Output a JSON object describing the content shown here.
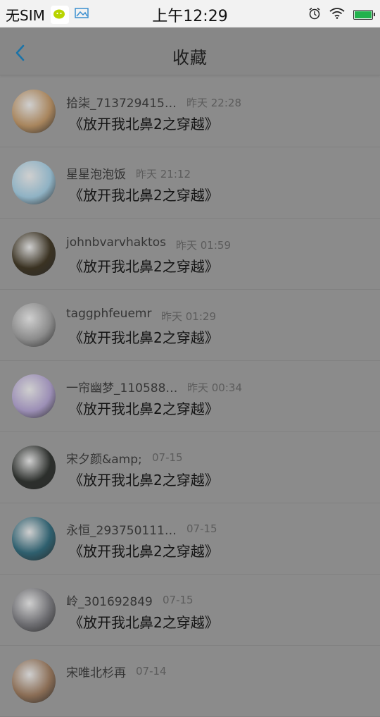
{
  "status_bar": {
    "carrier": "无SIM",
    "time": "上午12:29",
    "battery_level": 1.0,
    "icons": [
      "wechat-icon",
      "photo-icon",
      "alarm-icon",
      "wifi-icon",
      "battery-icon"
    ]
  },
  "nav": {
    "title": "收藏",
    "back_icon": "chevron-left-icon",
    "accent_color": "#1a73a8"
  },
  "items": [
    {
      "name": "拾柒_713729415…",
      "time": "昨天 22:28",
      "book": "《放开我北鼻2之穿越》",
      "avatar_color": "#a8855d"
    },
    {
      "name": "星星泡泡饭",
      "time": "昨天 21:12",
      "book": "《放开我北鼻2之穿越》",
      "avatar_color": "#8fb2c4"
    },
    {
      "name": "johnbvarvhaktos",
      "time": "昨天 01:59",
      "book": "《放开我北鼻2之穿越》",
      "avatar_color": "#3a3222"
    },
    {
      "name": "taggphfeuemr",
      "time": "昨天 01:29",
      "book": "《放开我北鼻2之穿越》",
      "avatar_color": "#8b8b8b"
    },
    {
      "name": "一帘幽梦_110588…",
      "time": "昨天 00:34",
      "book": "《放开我北鼻2之穿越》",
      "avatar_color": "#9c8fb6"
    },
    {
      "name": "宋夕颜&amp;",
      "time": "07-15",
      "book": "《放开我北鼻2之穿越》",
      "avatar_color": "#2c2f2c"
    },
    {
      "name": "永恒_293750111…",
      "time": "07-15",
      "book": "《放开我北鼻2之穿越》",
      "avatar_color": "#2e5f6e"
    },
    {
      "name": "岭_301692849",
      "time": "07-15",
      "book": "《放开我北鼻2之穿越》",
      "avatar_color": "#6e6e72"
    },
    {
      "name": "宋唯北杉再",
      "time": "07-14",
      "book": "",
      "avatar_color": "#8a6d55"
    }
  ]
}
